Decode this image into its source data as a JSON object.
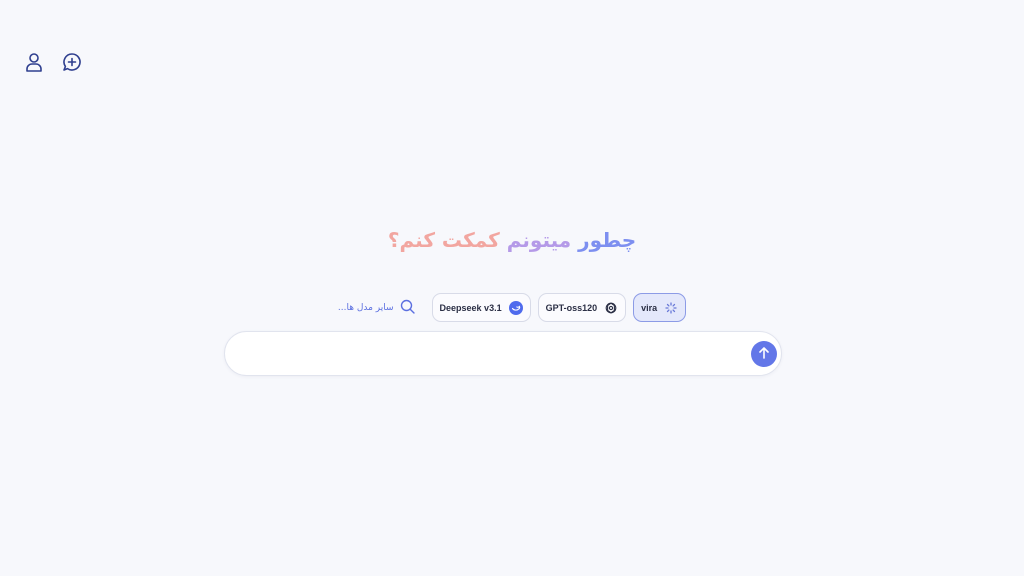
{
  "header": {
    "user_icon": "user-icon",
    "new_chat_icon": "new-chat-icon"
  },
  "headline": {
    "part1": "چطور",
    "part2": "میتونم",
    "part3": "کمکت کنم؟"
  },
  "models": {
    "items": [
      {
        "label": "vira",
        "icon": "vira-spinner-icon",
        "selected": true
      },
      {
        "label": "GPT-oss120",
        "icon": "openai-icon",
        "selected": false
      },
      {
        "label": "Deepseek v3.1",
        "icon": "deepseek-icon",
        "selected": false
      }
    ],
    "more_label": "سایر مدل ها...",
    "more_icon": "search-icon"
  },
  "composer": {
    "placeholder": "",
    "send_icon": "arrow-up-icon"
  },
  "colors": {
    "accent": "#6377e8",
    "background": "#f7f8fc",
    "headline_blue": "#7d8ff0",
    "headline_purple": "#b59ae8",
    "headline_pink": "#f2a6a0"
  }
}
